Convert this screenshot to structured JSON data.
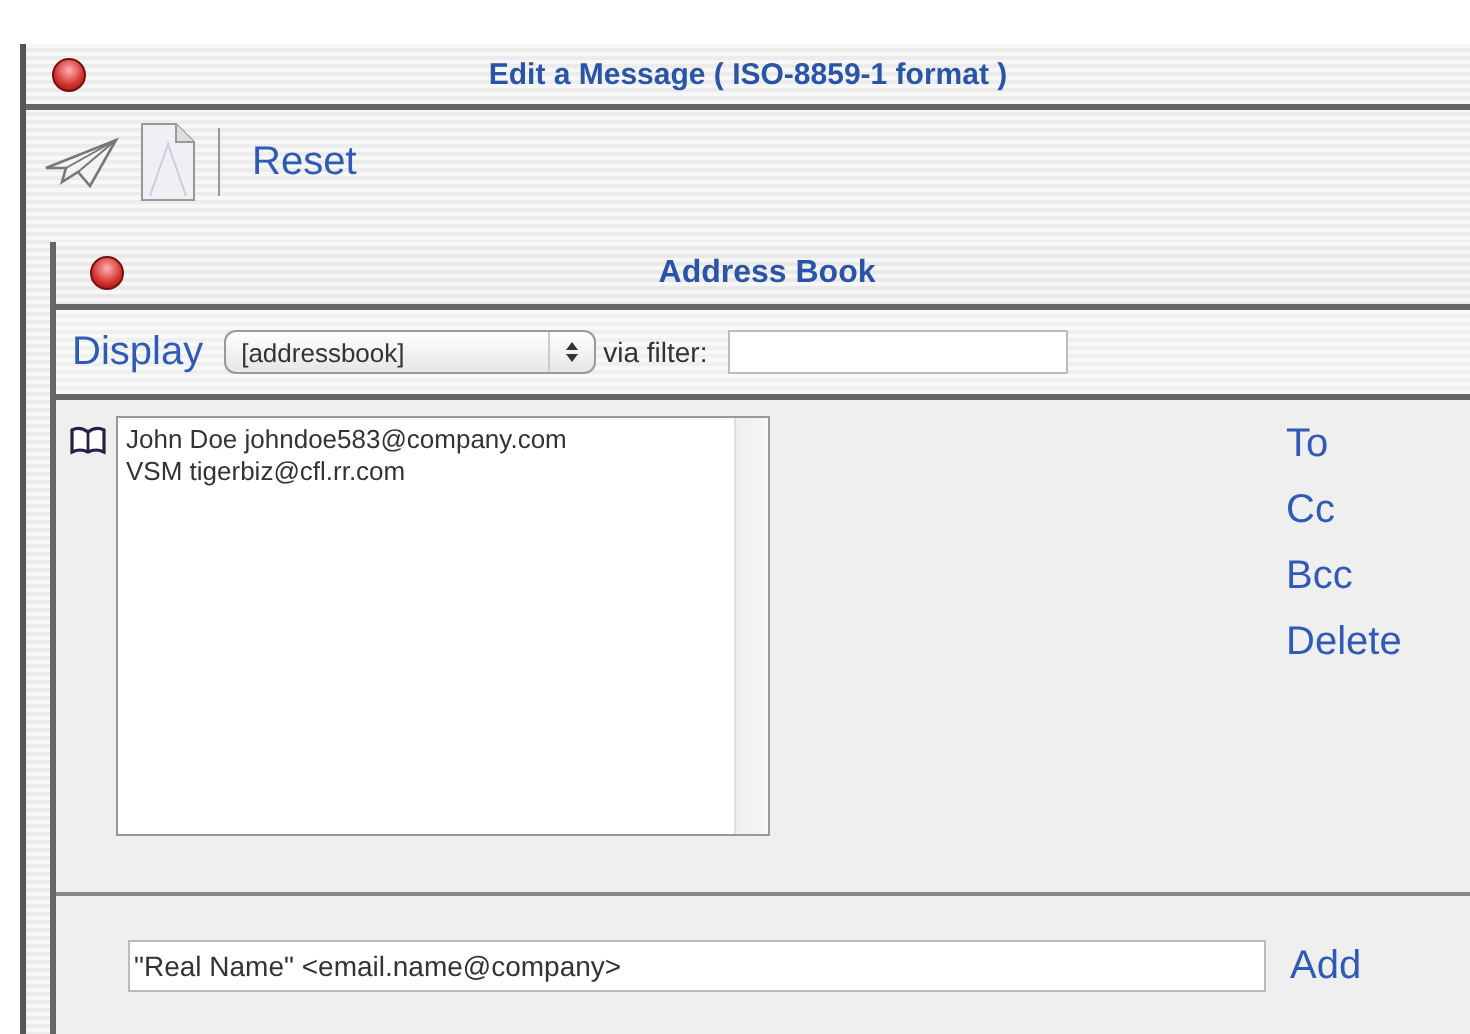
{
  "window": {
    "title": "Edit a Message ( ISO-8859-1 format )"
  },
  "toolbar": {
    "reset": "Reset"
  },
  "address_book": {
    "title": "Address Book",
    "display_label": "Display",
    "display_select": "[addressbook]",
    "filter_label": "via filter:",
    "entries": [
      {
        "text": "John Doe johndoe583@company.com",
        "selected": false
      },
      {
        "text": "VSM tigerbiz@cfl.rr.com",
        "selected": false
      }
    ],
    "actions": [
      "To",
      "Cc",
      "Bcc",
      "Delete"
    ],
    "add_field": {
      "value": "\"Real Name\" <email.name@company>"
    },
    "add_button": "Add"
  }
}
